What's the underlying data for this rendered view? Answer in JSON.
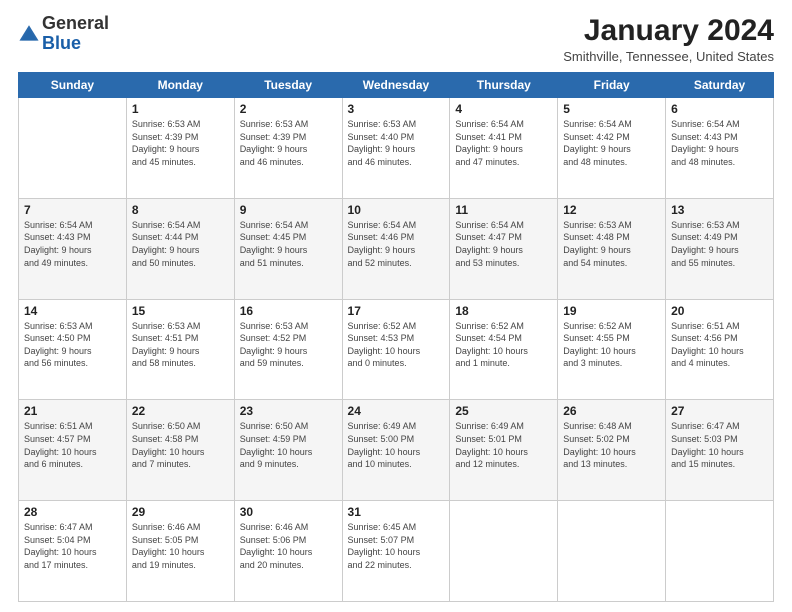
{
  "header": {
    "logo": {
      "line1": "General",
      "line2": "Blue"
    },
    "title": "January 2024",
    "location": "Smithville, Tennessee, United States"
  },
  "days_of_week": [
    "Sunday",
    "Monday",
    "Tuesday",
    "Wednesday",
    "Thursday",
    "Friday",
    "Saturday"
  ],
  "weeks": [
    [
      {
        "day": "",
        "info": ""
      },
      {
        "day": "1",
        "info": "Sunrise: 6:53 AM\nSunset: 4:39 PM\nDaylight: 9 hours\nand 45 minutes."
      },
      {
        "day": "2",
        "info": "Sunrise: 6:53 AM\nSunset: 4:39 PM\nDaylight: 9 hours\nand 46 minutes."
      },
      {
        "day": "3",
        "info": "Sunrise: 6:53 AM\nSunset: 4:40 PM\nDaylight: 9 hours\nand 46 minutes."
      },
      {
        "day": "4",
        "info": "Sunrise: 6:54 AM\nSunset: 4:41 PM\nDaylight: 9 hours\nand 47 minutes."
      },
      {
        "day": "5",
        "info": "Sunrise: 6:54 AM\nSunset: 4:42 PM\nDaylight: 9 hours\nand 48 minutes."
      },
      {
        "day": "6",
        "info": "Sunrise: 6:54 AM\nSunset: 4:43 PM\nDaylight: 9 hours\nand 48 minutes."
      }
    ],
    [
      {
        "day": "7",
        "info": "Sunrise: 6:54 AM\nSunset: 4:43 PM\nDaylight: 9 hours\nand 49 minutes."
      },
      {
        "day": "8",
        "info": "Sunrise: 6:54 AM\nSunset: 4:44 PM\nDaylight: 9 hours\nand 50 minutes."
      },
      {
        "day": "9",
        "info": "Sunrise: 6:54 AM\nSunset: 4:45 PM\nDaylight: 9 hours\nand 51 minutes."
      },
      {
        "day": "10",
        "info": "Sunrise: 6:54 AM\nSunset: 4:46 PM\nDaylight: 9 hours\nand 52 minutes."
      },
      {
        "day": "11",
        "info": "Sunrise: 6:54 AM\nSunset: 4:47 PM\nDaylight: 9 hours\nand 53 minutes."
      },
      {
        "day": "12",
        "info": "Sunrise: 6:53 AM\nSunset: 4:48 PM\nDaylight: 9 hours\nand 54 minutes."
      },
      {
        "day": "13",
        "info": "Sunrise: 6:53 AM\nSunset: 4:49 PM\nDaylight: 9 hours\nand 55 minutes."
      }
    ],
    [
      {
        "day": "14",
        "info": "Sunrise: 6:53 AM\nSunset: 4:50 PM\nDaylight: 9 hours\nand 56 minutes."
      },
      {
        "day": "15",
        "info": "Sunrise: 6:53 AM\nSunset: 4:51 PM\nDaylight: 9 hours\nand 58 minutes."
      },
      {
        "day": "16",
        "info": "Sunrise: 6:53 AM\nSunset: 4:52 PM\nDaylight: 9 hours\nand 59 minutes."
      },
      {
        "day": "17",
        "info": "Sunrise: 6:52 AM\nSunset: 4:53 PM\nDaylight: 10 hours\nand 0 minutes."
      },
      {
        "day": "18",
        "info": "Sunrise: 6:52 AM\nSunset: 4:54 PM\nDaylight: 10 hours\nand 1 minute."
      },
      {
        "day": "19",
        "info": "Sunrise: 6:52 AM\nSunset: 4:55 PM\nDaylight: 10 hours\nand 3 minutes."
      },
      {
        "day": "20",
        "info": "Sunrise: 6:51 AM\nSunset: 4:56 PM\nDaylight: 10 hours\nand 4 minutes."
      }
    ],
    [
      {
        "day": "21",
        "info": "Sunrise: 6:51 AM\nSunset: 4:57 PM\nDaylight: 10 hours\nand 6 minutes."
      },
      {
        "day": "22",
        "info": "Sunrise: 6:50 AM\nSunset: 4:58 PM\nDaylight: 10 hours\nand 7 minutes."
      },
      {
        "day": "23",
        "info": "Sunrise: 6:50 AM\nSunset: 4:59 PM\nDaylight: 10 hours\nand 9 minutes."
      },
      {
        "day": "24",
        "info": "Sunrise: 6:49 AM\nSunset: 5:00 PM\nDaylight: 10 hours\nand 10 minutes."
      },
      {
        "day": "25",
        "info": "Sunrise: 6:49 AM\nSunset: 5:01 PM\nDaylight: 10 hours\nand 12 minutes."
      },
      {
        "day": "26",
        "info": "Sunrise: 6:48 AM\nSunset: 5:02 PM\nDaylight: 10 hours\nand 13 minutes."
      },
      {
        "day": "27",
        "info": "Sunrise: 6:47 AM\nSunset: 5:03 PM\nDaylight: 10 hours\nand 15 minutes."
      }
    ],
    [
      {
        "day": "28",
        "info": "Sunrise: 6:47 AM\nSunset: 5:04 PM\nDaylight: 10 hours\nand 17 minutes."
      },
      {
        "day": "29",
        "info": "Sunrise: 6:46 AM\nSunset: 5:05 PM\nDaylight: 10 hours\nand 19 minutes."
      },
      {
        "day": "30",
        "info": "Sunrise: 6:46 AM\nSunset: 5:06 PM\nDaylight: 10 hours\nand 20 minutes."
      },
      {
        "day": "31",
        "info": "Sunrise: 6:45 AM\nSunset: 5:07 PM\nDaylight: 10 hours\nand 22 minutes."
      },
      {
        "day": "",
        "info": ""
      },
      {
        "day": "",
        "info": ""
      },
      {
        "day": "",
        "info": ""
      }
    ]
  ]
}
